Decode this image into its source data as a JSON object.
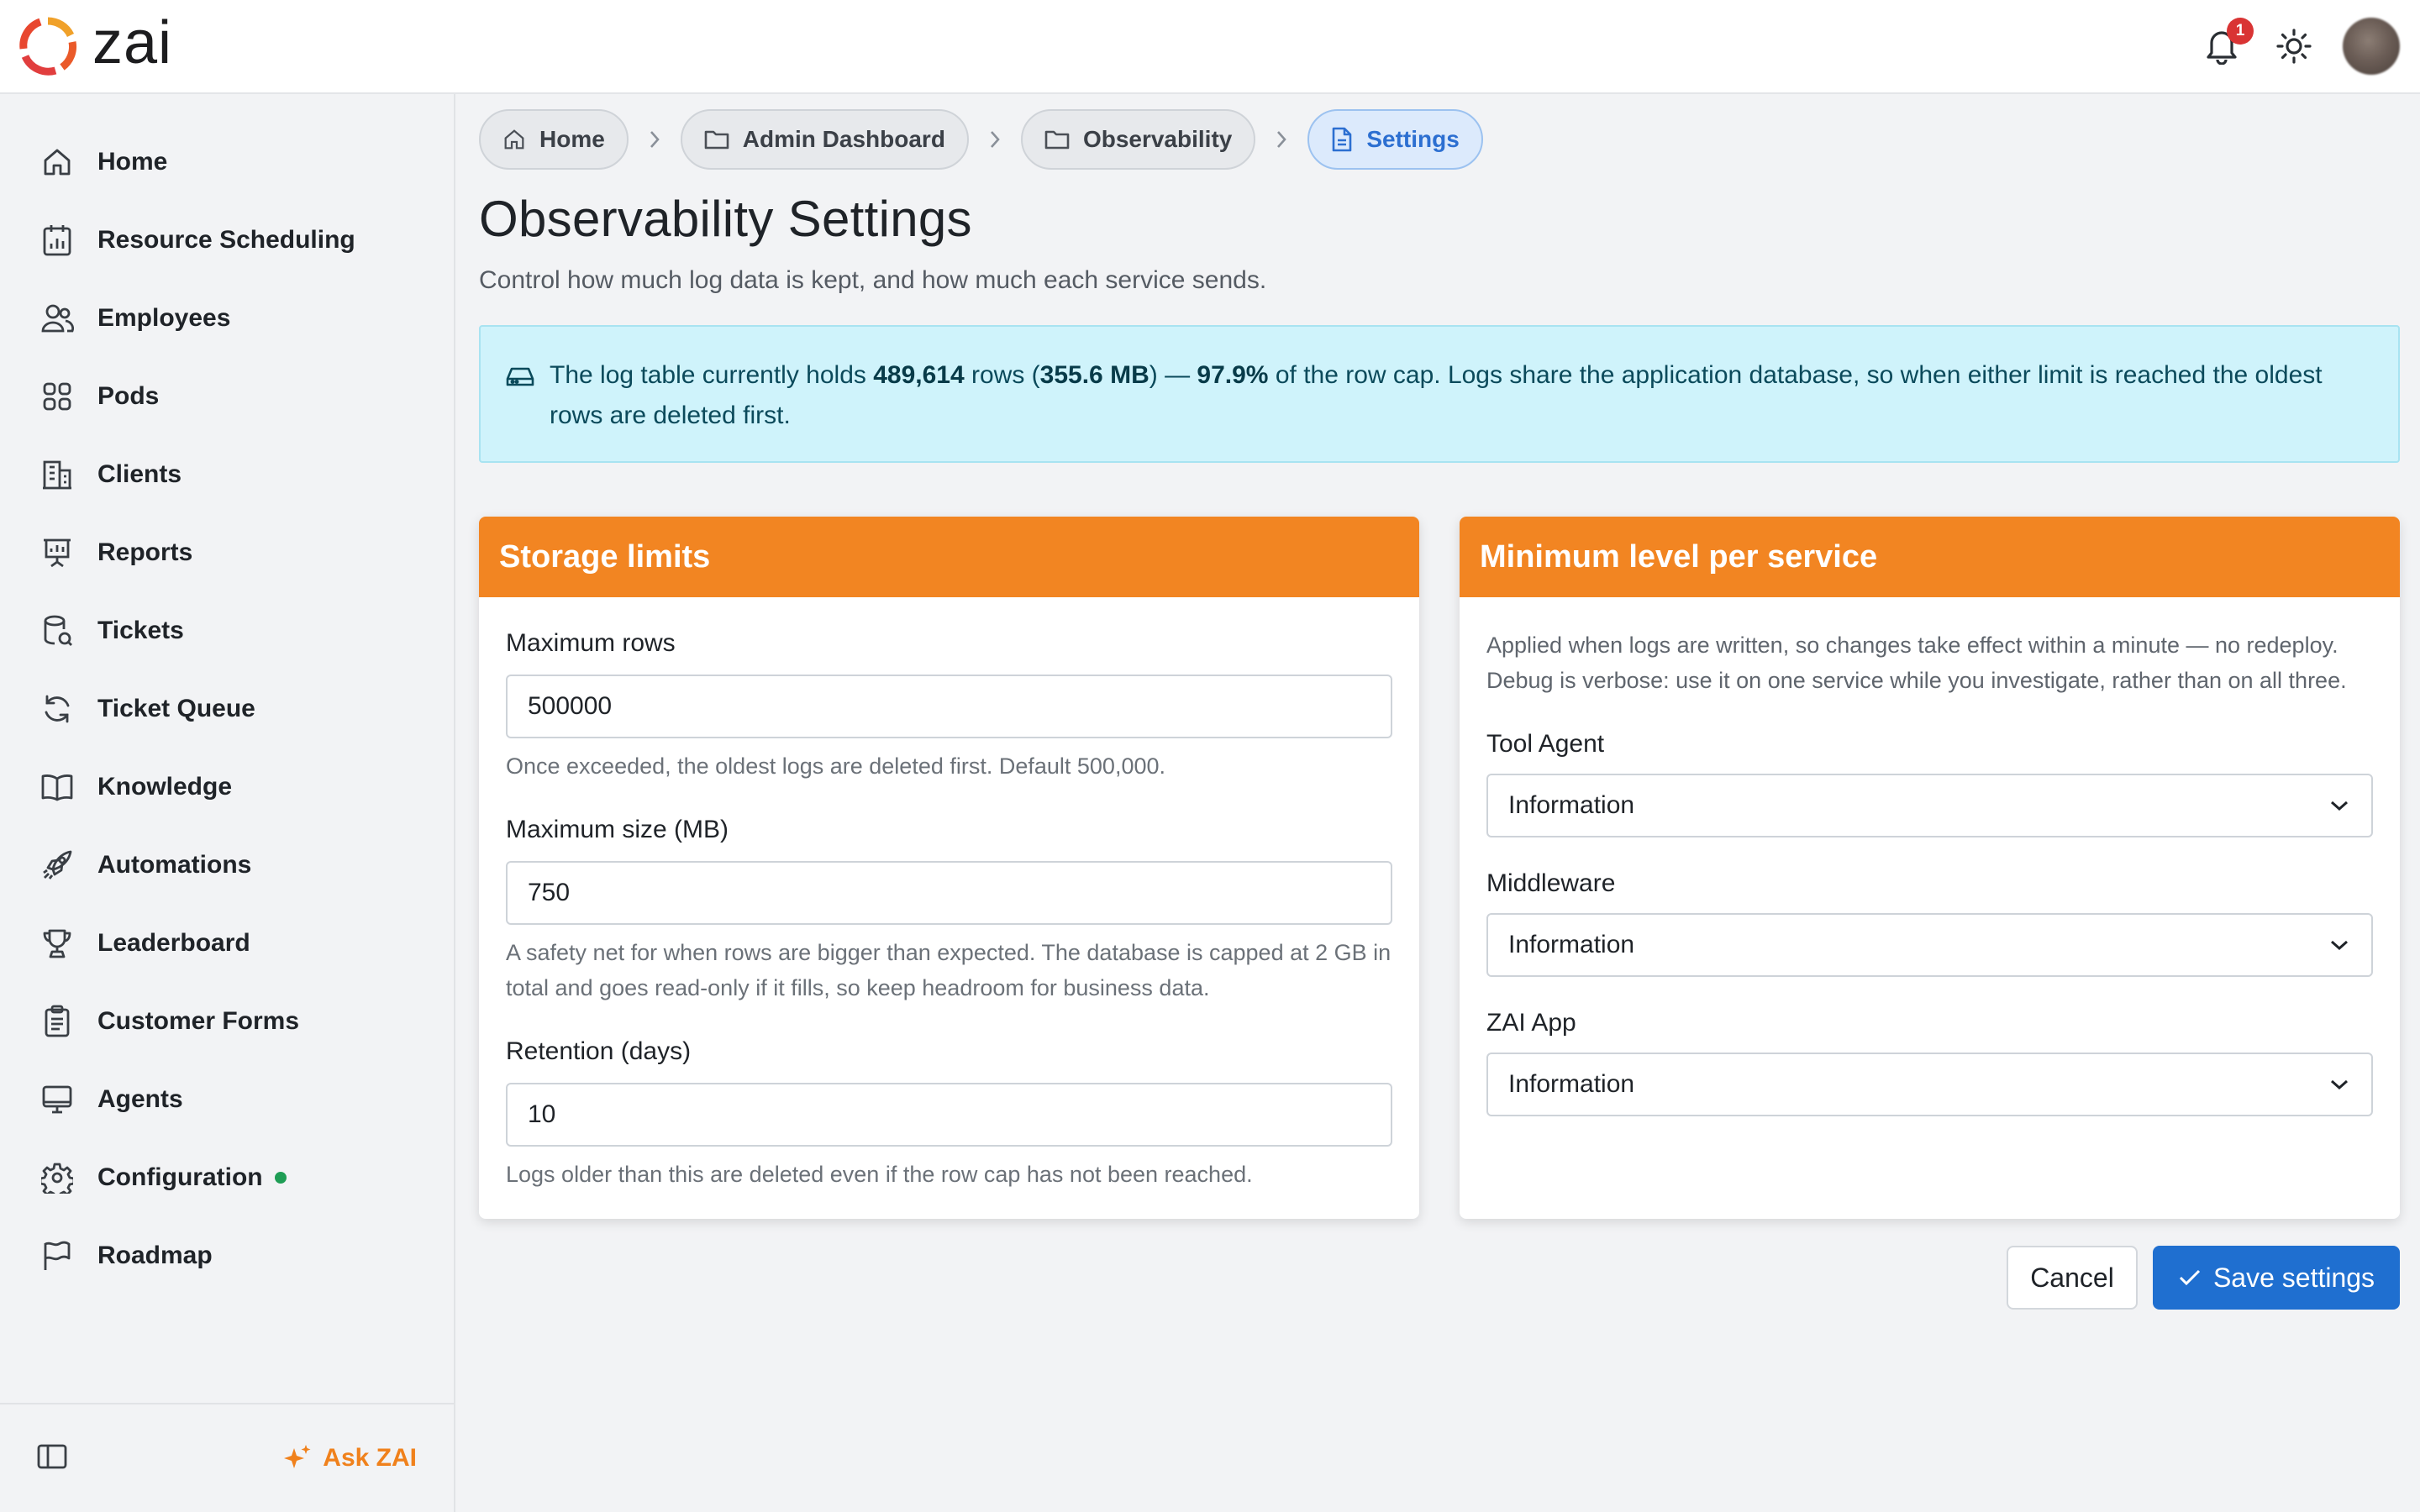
{
  "app": {
    "name": "zai"
  },
  "topbar": {
    "notification_count": "1"
  },
  "sidebar": {
    "items": [
      {
        "label": "Home",
        "icon": "home-icon"
      },
      {
        "label": "Resource Scheduling",
        "icon": "calendar-chart-icon"
      },
      {
        "label": "Employees",
        "icon": "users-icon"
      },
      {
        "label": "Pods",
        "icon": "grid-icon"
      },
      {
        "label": "Clients",
        "icon": "building-icon"
      },
      {
        "label": "Reports",
        "icon": "presentation-icon"
      },
      {
        "label": "Tickets",
        "icon": "ticket-icon"
      },
      {
        "label": "Ticket Queue",
        "icon": "refresh-icon"
      },
      {
        "label": "Knowledge",
        "icon": "book-icon"
      },
      {
        "label": "Automations",
        "icon": "rocket-icon"
      },
      {
        "label": "Leaderboard",
        "icon": "trophy-icon"
      },
      {
        "label": "Customer Forms",
        "icon": "clipboard-icon"
      },
      {
        "label": "Agents",
        "icon": "monitor-icon"
      },
      {
        "label": "Configuration",
        "icon": "gear-icon"
      },
      {
        "label": "Roadmap",
        "icon": "flag-icon"
      }
    ],
    "ask_label": "Ask ZAI"
  },
  "breadcrumb": {
    "home": "Home",
    "admin": "Admin Dashboard",
    "observability": "Observability",
    "settings": "Settings"
  },
  "page": {
    "title": "Observability Settings",
    "subtitle": "Control how much log data is kept, and how much each service sends."
  },
  "alert": {
    "text_1": "The log table currently holds ",
    "rows": "489,614",
    "text_2": " rows (",
    "size": "355.6 MB",
    "text_3": ") — ",
    "percent": "97.9%",
    "text_4": " of the row cap. Logs share the application database, so when either limit is reached the oldest rows are deleted first."
  },
  "storage": {
    "title": "Storage limits",
    "max_rows_label": "Maximum rows",
    "max_rows_value": "500000",
    "max_rows_help": "Once exceeded, the oldest logs are deleted first. Default 500,000.",
    "max_size_label": "Maximum size (MB)",
    "max_size_value": "750",
    "max_size_help": "A safety net for when rows are bigger than expected. The database is capped at 2 GB in total and goes read-only if it fills, so keep headroom for business data.",
    "retention_label": "Retention (days)",
    "retention_value": "10",
    "retention_help": "Logs older than this are deleted even if the row cap has not been reached."
  },
  "levels": {
    "title": "Minimum level per service",
    "description": "Applied when logs are written, so changes take effect within a minute — no redeploy. Debug is verbose: use it on one service while you investigate, rather than on all three.",
    "services": [
      {
        "label": "Tool Agent",
        "value": "Information"
      },
      {
        "label": "Middleware",
        "value": "Information"
      },
      {
        "label": "ZAI App",
        "value": "Information"
      }
    ]
  },
  "buttons": {
    "cancel": "Cancel",
    "save": "Save settings"
  },
  "colors": {
    "accent_orange": "#f28522",
    "primary_blue": "#1f6fd0",
    "alert_bg": "#cff3fb",
    "badge_red": "#d93434",
    "status_green": "#1f9d55"
  }
}
